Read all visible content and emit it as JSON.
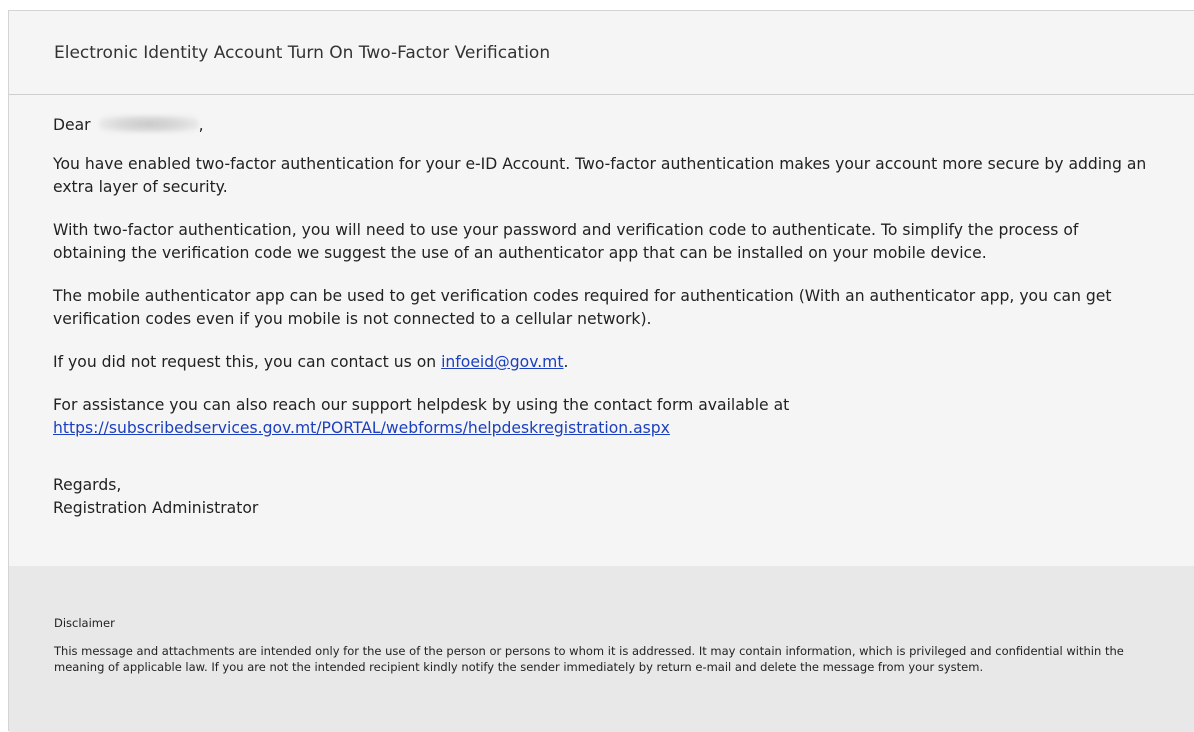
{
  "email": {
    "subject": "Electronic Identity Account Turn On Two-Factor Verification",
    "greeting_prefix": "Dear",
    "greeting_suffix": ",",
    "paragraphs": [
      "You have enabled two-factor authentication for your e-ID Account. Two-factor authentication makes your account more secure by adding an extra layer of security.",
      "With two-factor authentication, you will need to use your password and verification code to authenticate. To simplify the process of obtaining the verification code we suggest the use of an authenticator app that can be installed on your mobile device.",
      "The mobile authenticator app can be used to get verification codes required for authentication (With an authenticator app, you can get verification codes even if you mobile is not connected to a cellular network)."
    ],
    "contact_text": "If you did not request this, you can contact us on",
    "contact_email": "infoeid@gov.mt",
    "contact_suffix": ".",
    "assistance_text": "For assistance you can also reach our support helpdesk by using the contact form available at",
    "helpdesk_url": "https://subscribedservices.gov.mt/PORTAL/webforms/helpdeskregistration.aspx",
    "regards": "Regards,",
    "signature": "Registration Administrator"
  },
  "disclaimer": {
    "title": "Disclaimer",
    "text": "This message and attachments are intended only for the use of the person or persons to whom it is addressed. It may contain information, which is privileged and confidential within the meaning of applicable law. If you are not the intended recipient kindly notify the sender immediately by return e-mail and delete the message from your system."
  },
  "colors": {
    "link": "#1b3fbf",
    "header_background": "#f5f5f5",
    "disclaimer_background": "#e8e8e8"
  }
}
